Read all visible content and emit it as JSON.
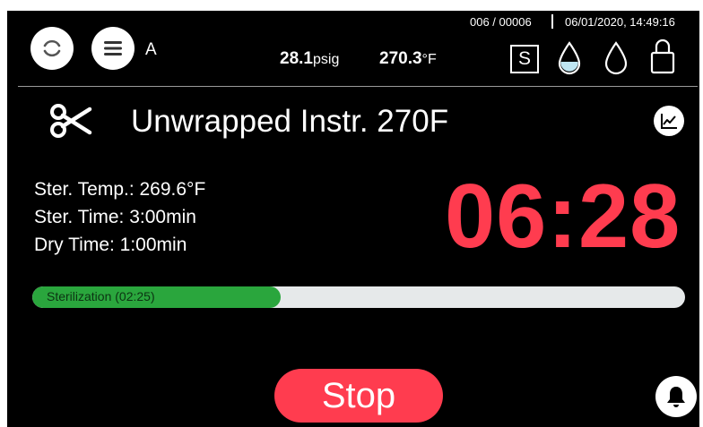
{
  "header": {
    "cycle_counter": "006 / 00006",
    "datetime": "06/01/2020, 14:49:16",
    "mode_letter": "A",
    "pressure_value": "28.1",
    "pressure_unit": "psig",
    "temperature_value": "270.3",
    "temperature_unit": "°F",
    "status_s_label": "S",
    "icons": [
      "refresh-icon",
      "menu-icon",
      "water-level-icon",
      "water-drop-icon",
      "lock-icon"
    ]
  },
  "program": {
    "icon": "scissors-icon",
    "title": "Unwrapped Instr. 270F",
    "chart_icon": "chart-icon"
  },
  "params": {
    "ster_temp": "Ster. Temp.: 269.6°F",
    "ster_time": "Ster. Time: 3:00min",
    "dry_time": "Dry Time: 1:00min"
  },
  "timer": {
    "value": "06:28"
  },
  "progress": {
    "label": "Sterilization (02:25)",
    "fraction": 0.38
  },
  "actions": {
    "stop_label": "Stop",
    "bell_icon": "bell-icon"
  },
  "colors": {
    "background": "#000000",
    "accent_red": "#ff3c4f",
    "progress_green": "#2aa63d",
    "track_grey": "#e6e9ea"
  }
}
